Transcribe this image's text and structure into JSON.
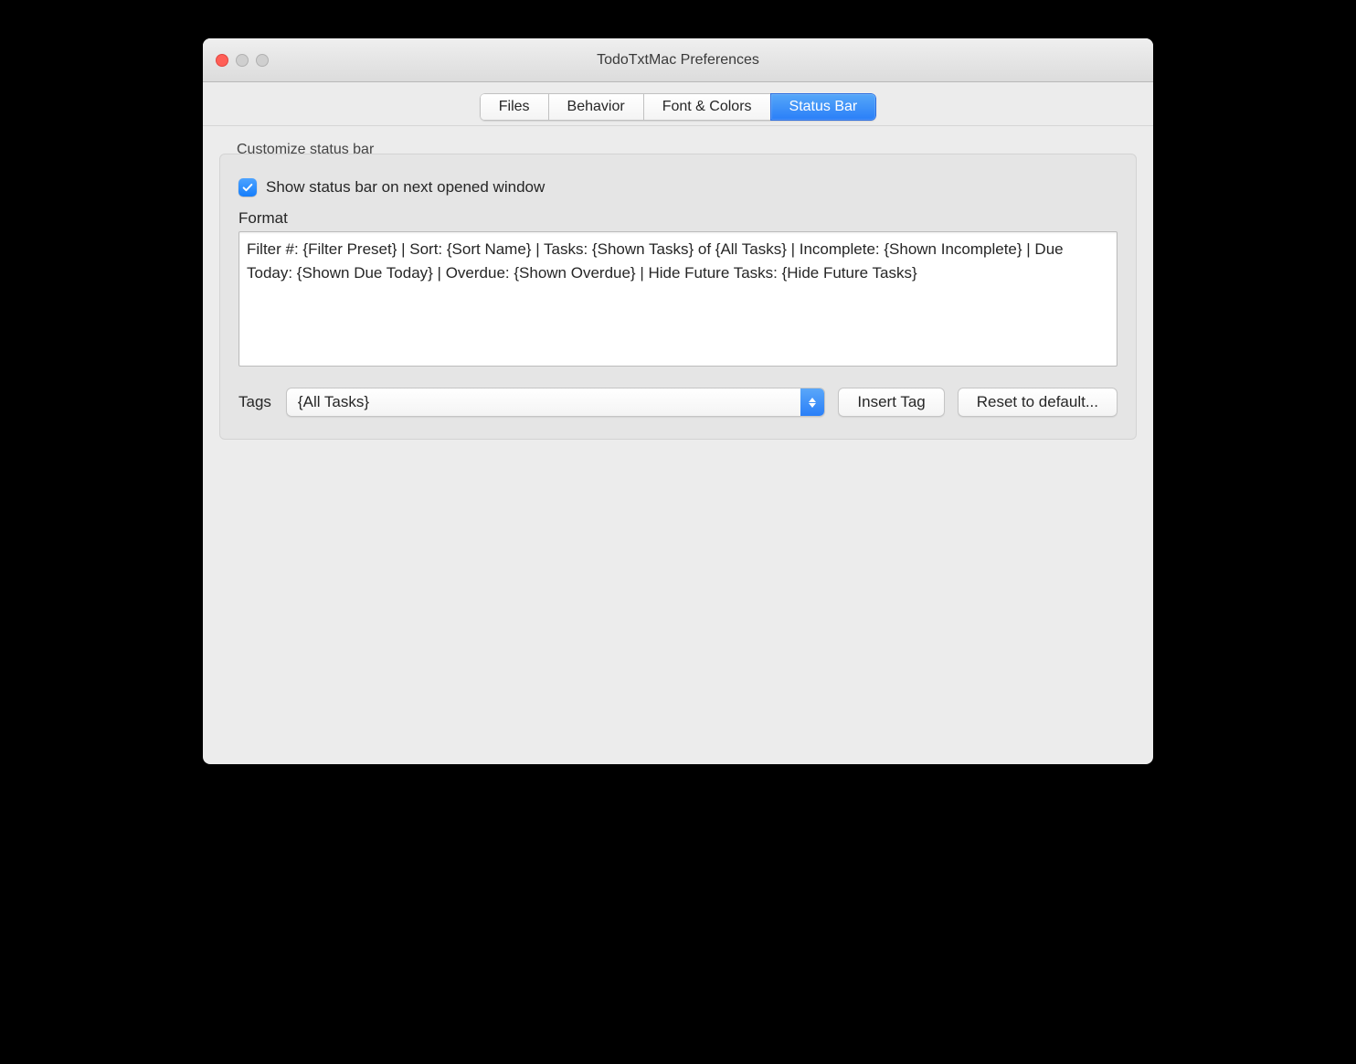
{
  "window": {
    "title": "TodoTxtMac Preferences"
  },
  "tabs": {
    "items": [
      "Files",
      "Behavior",
      "Font & Colors",
      "Status Bar"
    ],
    "active_index": 3
  },
  "group": {
    "label": "Customize status bar",
    "checkbox": {
      "checked": true,
      "label": "Show status bar on next opened window"
    },
    "format_label": "Format",
    "format_value": "Filter #: {Filter Preset} | Sort: {Sort Name} | Tasks: {Shown Tasks} of {All Tasks} | Incomplete: {Shown Incomplete} | Due Today: {Shown Due Today} | Overdue: {Shown Overdue} | Hide Future Tasks: {Hide Future Tasks}",
    "tags_label": "Tags",
    "tags_selected": "{All Tasks}",
    "insert_button": "Insert Tag",
    "reset_button": "Reset to default..."
  }
}
